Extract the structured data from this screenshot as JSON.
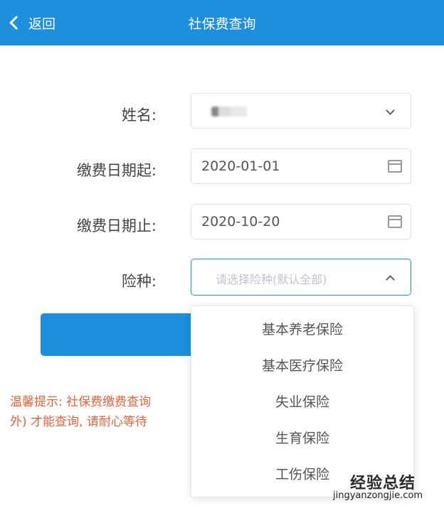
{
  "header": {
    "back_label": "返回",
    "title": "社保费查询"
  },
  "form": {
    "name_label": "姓名:",
    "start_date_label": "缴费日期起:",
    "start_date_value": "2020-01-01",
    "end_date_label": "缴费日期止:",
    "end_date_value": "2020-10-20",
    "insurance_label": "险种:",
    "insurance_placeholder": "请选择险种(默认全部)"
  },
  "tip": {
    "line1": "温馨提示: 社保费缴费查询",
    "line2": "外) 才能查询, 请耐心等待"
  },
  "dropdown": {
    "options": [
      "基本养老保险",
      "基本医疗保险",
      "失业保险",
      "生育保险",
      "工伤保险"
    ]
  },
  "watermark": {
    "brand": "经验总结",
    "url": "jingyanzongjie.com"
  },
  "colors": {
    "primary": "#1e8fdc",
    "tip": "#e8643a"
  },
  "icons": [
    "chevron-left-icon",
    "chevron-down-icon",
    "calendar-icon",
    "chevron-up-icon"
  ]
}
